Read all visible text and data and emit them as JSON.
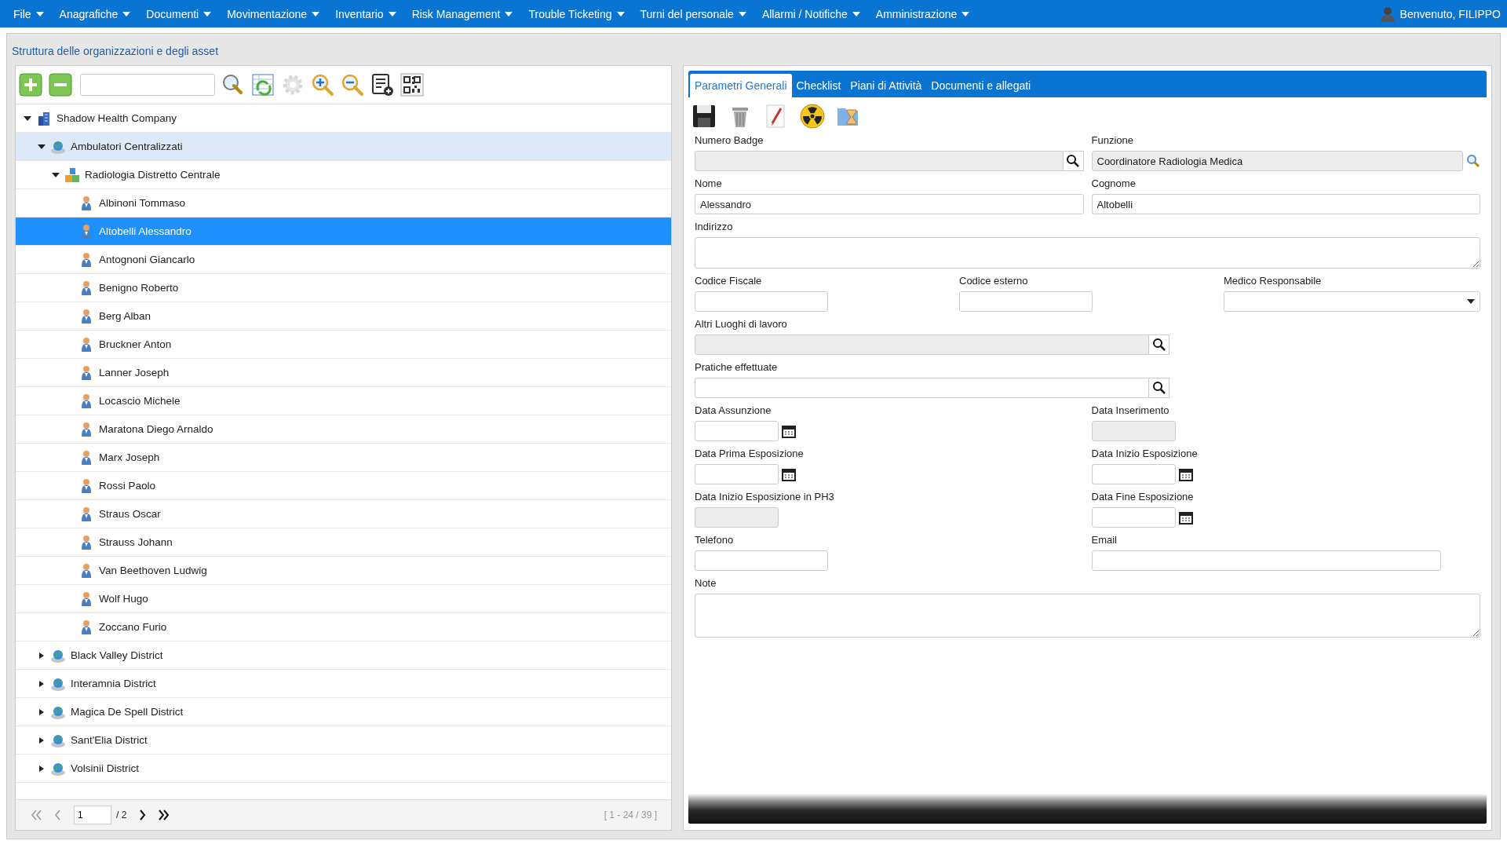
{
  "menu": {
    "items": [
      {
        "label": "File"
      },
      {
        "label": "Anagrafiche"
      },
      {
        "label": "Documenti"
      },
      {
        "label": "Movimentazione"
      },
      {
        "label": "Inventario"
      },
      {
        "label": "Risk Management"
      },
      {
        "label": "Trouble Ticketing"
      },
      {
        "label": "Turni del personale"
      },
      {
        "label": "Allarmi / Notifiche"
      },
      {
        "label": "Amministrazione"
      }
    ],
    "user": "Benvenuto, FILIPPO"
  },
  "page_title": "Struttura delle organizzazioni e degli asset",
  "tree_toolbar": [
    {
      "kind": "add",
      "disabled": false
    },
    {
      "kind": "remove",
      "disabled": false
    },
    {
      "kind": "search_input",
      "disabled": false
    },
    {
      "kind": "search",
      "disabled": false
    },
    {
      "kind": "refresh",
      "disabled": false
    },
    {
      "kind": "settings",
      "disabled": true
    },
    {
      "kind": "zoom_in",
      "disabled": false
    },
    {
      "kind": "zoom_out",
      "disabled": false
    },
    {
      "kind": "list_add",
      "disabled": false
    },
    {
      "kind": "qr",
      "disabled": false
    }
  ],
  "tree": [
    {
      "kind": "company",
      "label": "Shadow Health Company",
      "expanded": true,
      "selected": false,
      "highlighted": false,
      "children": [
        {
          "kind": "district",
          "label": "Ambulatori Centralizzati",
          "expanded": true,
          "selected": false,
          "highlighted": true,
          "children": [
            {
              "kind": "department",
              "label": "Radiologia Distretto Centrale",
              "expanded": true,
              "selected": false,
              "highlighted": false,
              "children": [
                {
                  "kind": "person",
                  "label": "Albinoni Tommaso",
                  "selected": false,
                  "highlighted": false
                },
                {
                  "kind": "person",
                  "label": "Altobelli Alessandro",
                  "selected": true,
                  "highlighted": false
                },
                {
                  "kind": "person",
                  "label": "Antognoni Giancarlo",
                  "selected": false,
                  "highlighted": false
                },
                {
                  "kind": "person",
                  "label": "Benigno Roberto",
                  "selected": false,
                  "highlighted": false
                },
                {
                  "kind": "person",
                  "label": "Berg Alban",
                  "selected": false,
                  "highlighted": false
                },
                {
                  "kind": "person",
                  "label": "Bruckner Anton",
                  "selected": false,
                  "highlighted": false
                },
                {
                  "kind": "person",
                  "label": "Lanner Joseph",
                  "selected": false,
                  "highlighted": false
                },
                {
                  "kind": "person",
                  "label": "Locascio Michele",
                  "selected": false,
                  "highlighted": false
                },
                {
                  "kind": "person",
                  "label": "Maratona Diego Arnaldo",
                  "selected": false,
                  "highlighted": false
                },
                {
                  "kind": "person",
                  "label": "Marx Joseph",
                  "selected": false,
                  "highlighted": false
                },
                {
                  "kind": "person",
                  "label": "Rossi Paolo",
                  "selected": false,
                  "highlighted": false
                },
                {
                  "kind": "person",
                  "label": "Straus Oscar",
                  "selected": false,
                  "highlighted": false
                },
                {
                  "kind": "person",
                  "label": "Strauss Johann",
                  "selected": false,
                  "highlighted": false
                },
                {
                  "kind": "person",
                  "label": "Van Beethoven Ludwig",
                  "selected": false,
                  "highlighted": false
                },
                {
                  "kind": "person",
                  "label": "Wolf Hugo",
                  "selected": false,
                  "highlighted": false
                },
                {
                  "kind": "person",
                  "label": "Zoccano Furio",
                  "selected": false,
                  "highlighted": false
                }
              ]
            }
          ]
        },
        {
          "kind": "district",
          "label": "Black Valley District",
          "expanded": false,
          "selected": false,
          "highlighted": false
        },
        {
          "kind": "district",
          "label": "Interamnia District",
          "expanded": false,
          "selected": false,
          "highlighted": false
        },
        {
          "kind": "district",
          "label": "Magica De Spell District",
          "expanded": false,
          "selected": false,
          "highlighted": false
        },
        {
          "kind": "district",
          "label": "Sant'Elia District",
          "expanded": false,
          "selected": false,
          "highlighted": false
        },
        {
          "kind": "district",
          "label": "Volsinii District",
          "expanded": false,
          "selected": false,
          "highlighted": false
        }
      ]
    }
  ],
  "pager": {
    "page": "1",
    "pages": "/ 2",
    "range": "[ 1 - 24 / 39 ]",
    "buttons": [
      {
        "kind": "first",
        "disabled": true
      },
      {
        "kind": "prev",
        "disabled": true
      },
      {
        "kind": "next",
        "disabled": false
      },
      {
        "kind": "last",
        "disabled": false
      }
    ]
  },
  "tabs": [
    {
      "label": "Parametri Generali",
      "selected": true
    },
    {
      "label": "Checklist",
      "selected": false
    },
    {
      "label": "Piani di Attività",
      "selected": false
    },
    {
      "label": "Documenti e allegati",
      "selected": false
    }
  ],
  "actions": [
    {
      "kind": "save"
    },
    {
      "kind": "delete"
    },
    {
      "kind": "edit"
    },
    {
      "kind": "radiation"
    },
    {
      "kind": "history"
    }
  ],
  "form": [
    {
      "fields": [
        {
          "kind": "search",
          "label": "Numero Badge",
          "disabled": true
        },
        {
          "kind": "lookup",
          "label": "Funzione",
          "value": "Coordinatore Radiologia Medica",
          "disabled": true
        }
      ]
    },
    {
      "fields": [
        {
          "kind": "text",
          "label": "Nome",
          "value": "Alessandro",
          "disabled": false
        },
        {
          "kind": "text",
          "label": "Cognome",
          "value": "Altobelli",
          "disabled": false
        }
      ]
    },
    {
      "fields": [
        {
          "kind": "textarea",
          "label": "Indirizzo",
          "disabled": false
        }
      ]
    },
    {
      "fields": [
        {
          "kind": "short",
          "label": "Codice Fiscale",
          "disabled": false
        },
        {
          "kind": "short",
          "label": "Codice esterno",
          "disabled": false
        },
        {
          "kind": "select",
          "label": "Medico Responsabile",
          "disabled": false
        }
      ]
    },
    {
      "fields": [
        {
          "kind": "search",
          "label": "Altri Luoghi di lavoro",
          "disabled": true
        }
      ]
    },
    {
      "fields": [
        {
          "kind": "search",
          "label": "Pratiche effettuate",
          "disabled": false
        }
      ]
    },
    {
      "fields": [
        {
          "kind": "date",
          "label": "Data Assunzione",
          "disabled": false
        },
        {
          "kind": "date",
          "label": "Data Inserimento",
          "disabled": true
        }
      ]
    },
    {
      "fields": [
        {
          "kind": "date",
          "label": "Data Prima Esposizione",
          "disabled": false
        },
        {
          "kind": "date",
          "label": "Data Inizio Esposizione",
          "disabled": false
        }
      ]
    },
    {
      "fields": [
        {
          "kind": "date",
          "label": "Data Inizio Esposizione in PH3",
          "disabled": true
        },
        {
          "kind": "date",
          "label": "Data Fine Esposizione",
          "disabled": false
        }
      ]
    },
    {
      "fields": [
        {
          "kind": "short",
          "label": "Telefono",
          "disabled": false
        },
        {
          "kind": "medium",
          "label": "Email",
          "disabled": false
        }
      ]
    },
    {
      "fields": [
        {
          "kind": "note",
          "label": "Note",
          "disabled": false
        }
      ]
    }
  ]
}
